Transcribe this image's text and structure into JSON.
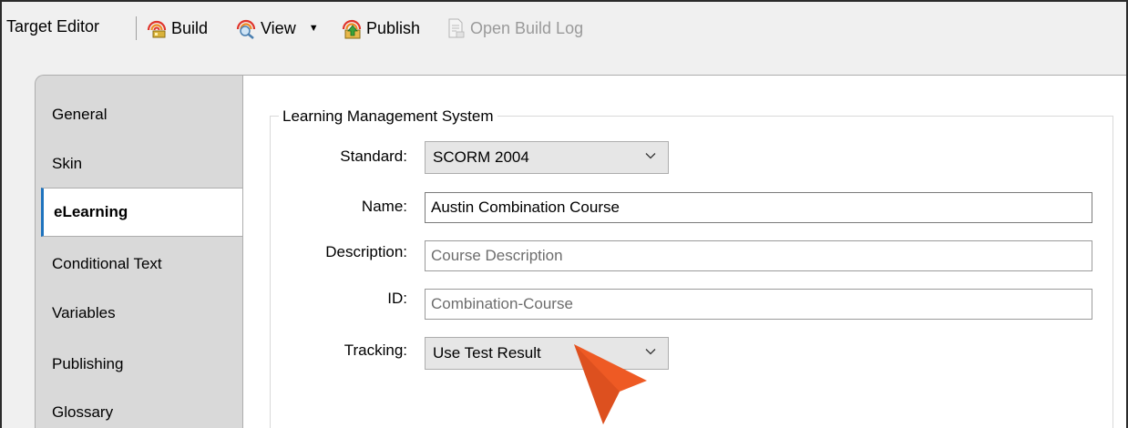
{
  "toolbar": {
    "title": "Target Editor",
    "build_label": "Build",
    "view_label": "View",
    "publish_label": "Publish",
    "open_build_log_label": "Open Build Log"
  },
  "tabs": [
    {
      "label": "General"
    },
    {
      "label": "Skin"
    },
    {
      "label": "eLearning"
    },
    {
      "label": "Conditional Text"
    },
    {
      "label": "Variables"
    },
    {
      "label": "Publishing"
    },
    {
      "label": "Glossary"
    }
  ],
  "lms": {
    "legend": "Learning Management System",
    "standard_label": "Standard:",
    "standard_value": "SCORM 2004",
    "name_label": "Name:",
    "name_value": "Austin Combination Course",
    "description_label": "Description:",
    "description_placeholder": "Course Description",
    "id_label": "ID:",
    "id_placeholder": "Combination-Course",
    "tracking_label": "Tracking:",
    "tracking_value": "Use Test Result"
  },
  "colors": {
    "accent": "#1e73be",
    "pointer": "#ee5a24"
  }
}
